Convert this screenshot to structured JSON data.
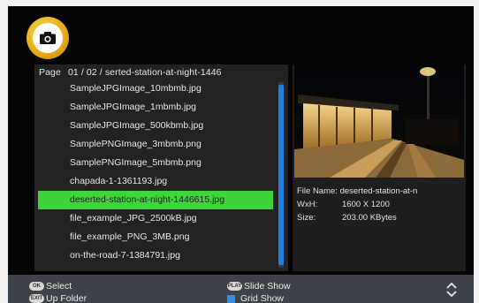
{
  "browser": {
    "page_label": "Page",
    "page_number": "01 / 02",
    "folder_name": "serted-station-at-night-1446",
    "files": [
      "SampleJPGImage_10mbmb.jpg",
      "SampleJPGImage_1mbmb.jpg",
      "SampleJPGImage_500kbmb.jpg",
      "SamplePNGImage_3mbmb.png",
      "SamplePNGImage_5mbmb.png",
      "chapada-1-1361193.jpg",
      "deserted-station-at-night-1446615.jpg",
      "file_example_JPG_2500kB.jpg",
      "file_example_PNG_3MB.png",
      "on-the-road-7-1384791.jpg"
    ],
    "selected_index": 6
  },
  "info": {
    "file_name_label": "File Name:",
    "file_name_value": "deserted-station-at-n",
    "size_wh_label": "WxH:",
    "size_wh_value": "1600 X 1200",
    "size_label": "Size:",
    "size_value": "203.00 KBytes"
  },
  "footer": {
    "select_key": "OK",
    "select_label": "Select",
    "up_key": "EXIT",
    "up_label": "Up Folder",
    "slide_key": "PLAY",
    "slide_label": "Slide Show",
    "grid_label": "Grid Show"
  },
  "colors": {
    "selection": "#3fd33c",
    "scrollbar": "#1e82e0",
    "grid_key": "#2e8ee8",
    "logo": "#e5a916"
  },
  "icons": {
    "logo": "camera-icon",
    "page_nav": "chevron-up-down-icon"
  }
}
